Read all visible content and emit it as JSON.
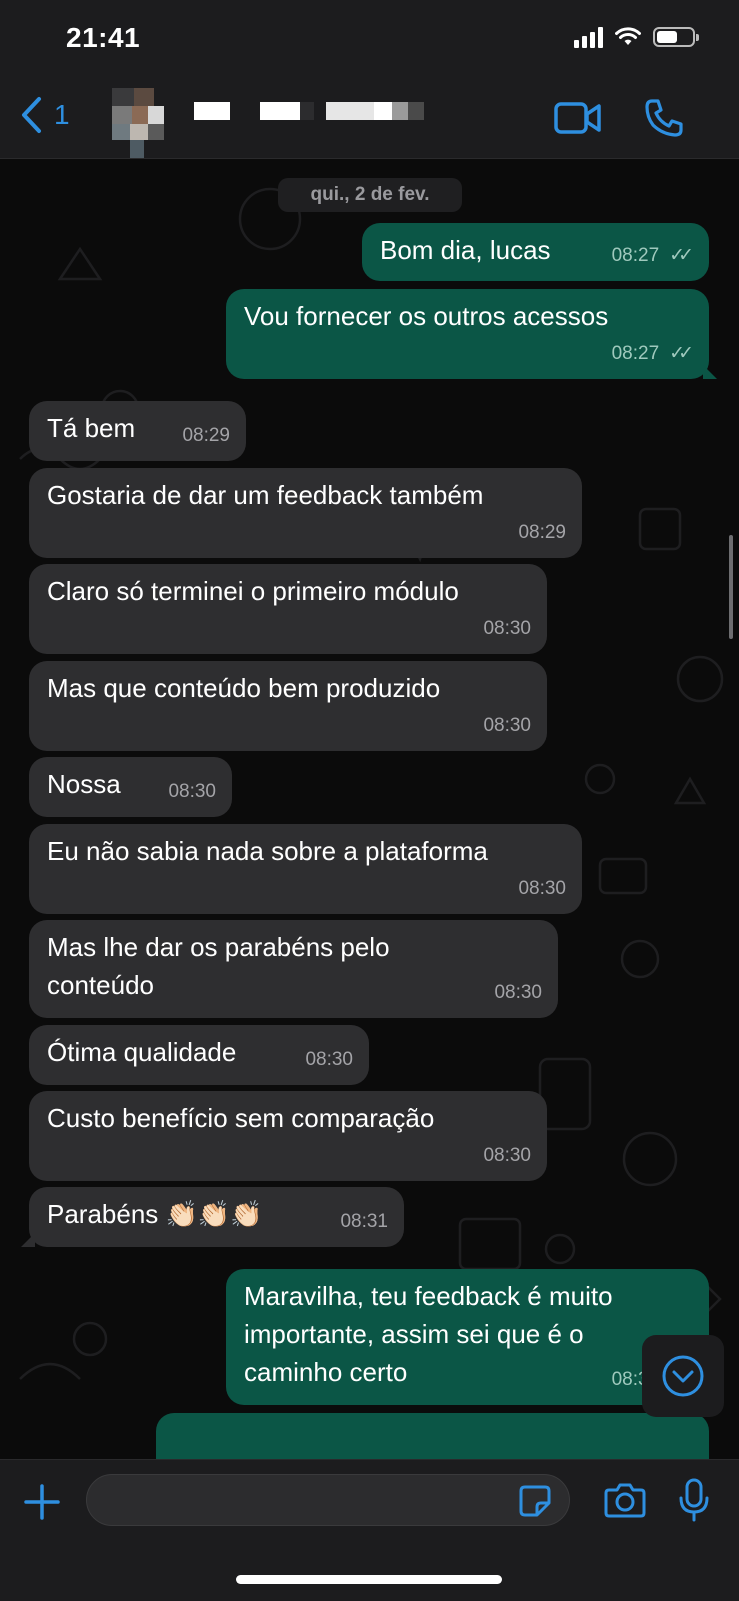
{
  "status_bar": {
    "time": "21:41",
    "battery_level": 0.6
  },
  "header": {
    "back_count": "1",
    "icons": {
      "back": "chevron-left-icon",
      "video": "video-camera-icon",
      "call": "phone-icon"
    },
    "accent_color": "#2e8fe0"
  },
  "chat": {
    "date_label": "qui., 2 de fev.",
    "messages": [
      {
        "dir": "out",
        "text": "Bom dia, lucas",
        "time": "08:27",
        "status": "read"
      },
      {
        "dir": "out",
        "text": "Vou fornecer os outros acessos",
        "time": "08:27",
        "status": "read"
      },
      {
        "dir": "in",
        "text": "Tá bem",
        "time": "08:29"
      },
      {
        "dir": "in",
        "text": "Gostaria de dar um feedback também",
        "time": "08:29"
      },
      {
        "dir": "in",
        "text": "Claro só terminei o primeiro módulo",
        "time": "08:30"
      },
      {
        "dir": "in",
        "text": "Mas que conteúdo bem produzido",
        "time": "08:30"
      },
      {
        "dir": "in",
        "text": "Nossa",
        "time": "08:30"
      },
      {
        "dir": "in",
        "text": "Eu não sabia nada sobre a plataforma",
        "time": "08:30"
      },
      {
        "dir": "in",
        "text": "Mas lhe dar os parabéns pelo conteúdo",
        "time": "08:30"
      },
      {
        "dir": "in",
        "text": "Ótima qualidade",
        "time": "08:30"
      },
      {
        "dir": "in",
        "text": "Custo benefício sem comparação",
        "time": "08:30"
      },
      {
        "dir": "in",
        "text": "Parabéns 👏🏻👏🏻👏🏻",
        "time": "08:31"
      },
      {
        "dir": "out",
        "text": "Maravilha, teu feedback é muito importante, assim sei que é o caminho certo",
        "time": "08:33",
        "status": "read"
      }
    ],
    "colors": {
      "incoming_bubble": "#2e2e30",
      "outgoing_bubble": "#0b5646"
    }
  },
  "input_bar": {
    "placeholder": "",
    "icons": {
      "attach": "plus-icon",
      "sticker": "sticker-icon",
      "camera": "camera-icon",
      "mic": "microphone-icon"
    }
  }
}
